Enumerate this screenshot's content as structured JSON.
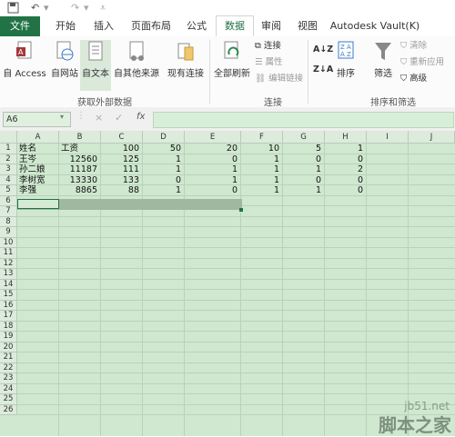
{
  "quick_access": {
    "save_icon": "save-icon",
    "undo_icon": "undo-icon",
    "redo_icon": "redo-icon"
  },
  "tabs": [
    "文件",
    "开始",
    "插入",
    "页面布局",
    "公式",
    "数据",
    "审阅",
    "视图",
    "Autodesk Vault(K)"
  ],
  "active_tab": "数据",
  "ribbon": {
    "external": {
      "access": "自 Access",
      "web": "自网站",
      "text": "自文本",
      "other": "自其他来源",
      "existing": "现有连接",
      "group_label": "获取外部数据"
    },
    "connections": {
      "refresh_all": "全部刷新",
      "connections": "连接",
      "properties": "属性",
      "edit_links": "编辑链接",
      "group_label": "连接"
    },
    "sort_filter": {
      "sort": "排序",
      "filter": "筛选",
      "clear": "清除",
      "reapply": "重新应用",
      "advanced": "高级",
      "group_label": "排序和筛选"
    }
  },
  "formula_bar": {
    "name_box": "A6",
    "fx": "fx",
    "cancel": "×",
    "enter": "✓"
  },
  "columns": [
    "A",
    "B",
    "C",
    "D",
    "E",
    "F",
    "G",
    "H",
    "I",
    "J"
  ],
  "rows": [
    "1",
    "2",
    "3",
    "4",
    "5",
    "6",
    "7",
    "8",
    "9",
    "10",
    "11",
    "12",
    "13",
    "14",
    "15",
    "16",
    "17",
    "18",
    "19",
    "20",
    "21",
    "22",
    "23",
    "24",
    "25",
    "26"
  ],
  "cells": [
    [
      "姓名",
      "工资",
      "100",
      "50",
      "20",
      "10",
      "5",
      "1"
    ],
    [
      "王岑",
      "12560",
      "125",
      "1",
      "0",
      "1",
      "0",
      "0"
    ],
    [
      "孙二娘",
      "11187",
      "111",
      "1",
      "1",
      "1",
      "1",
      "2"
    ],
    [
      "李树宽",
      "13330",
      "133",
      "0",
      "1",
      "1",
      "0",
      "0"
    ],
    [
      "李强",
      "8865",
      "88",
      "1",
      "0",
      "1",
      "1",
      "0"
    ]
  ],
  "watermark": {
    "line1": "jb51.net",
    "line2": "脚本之家"
  }
}
